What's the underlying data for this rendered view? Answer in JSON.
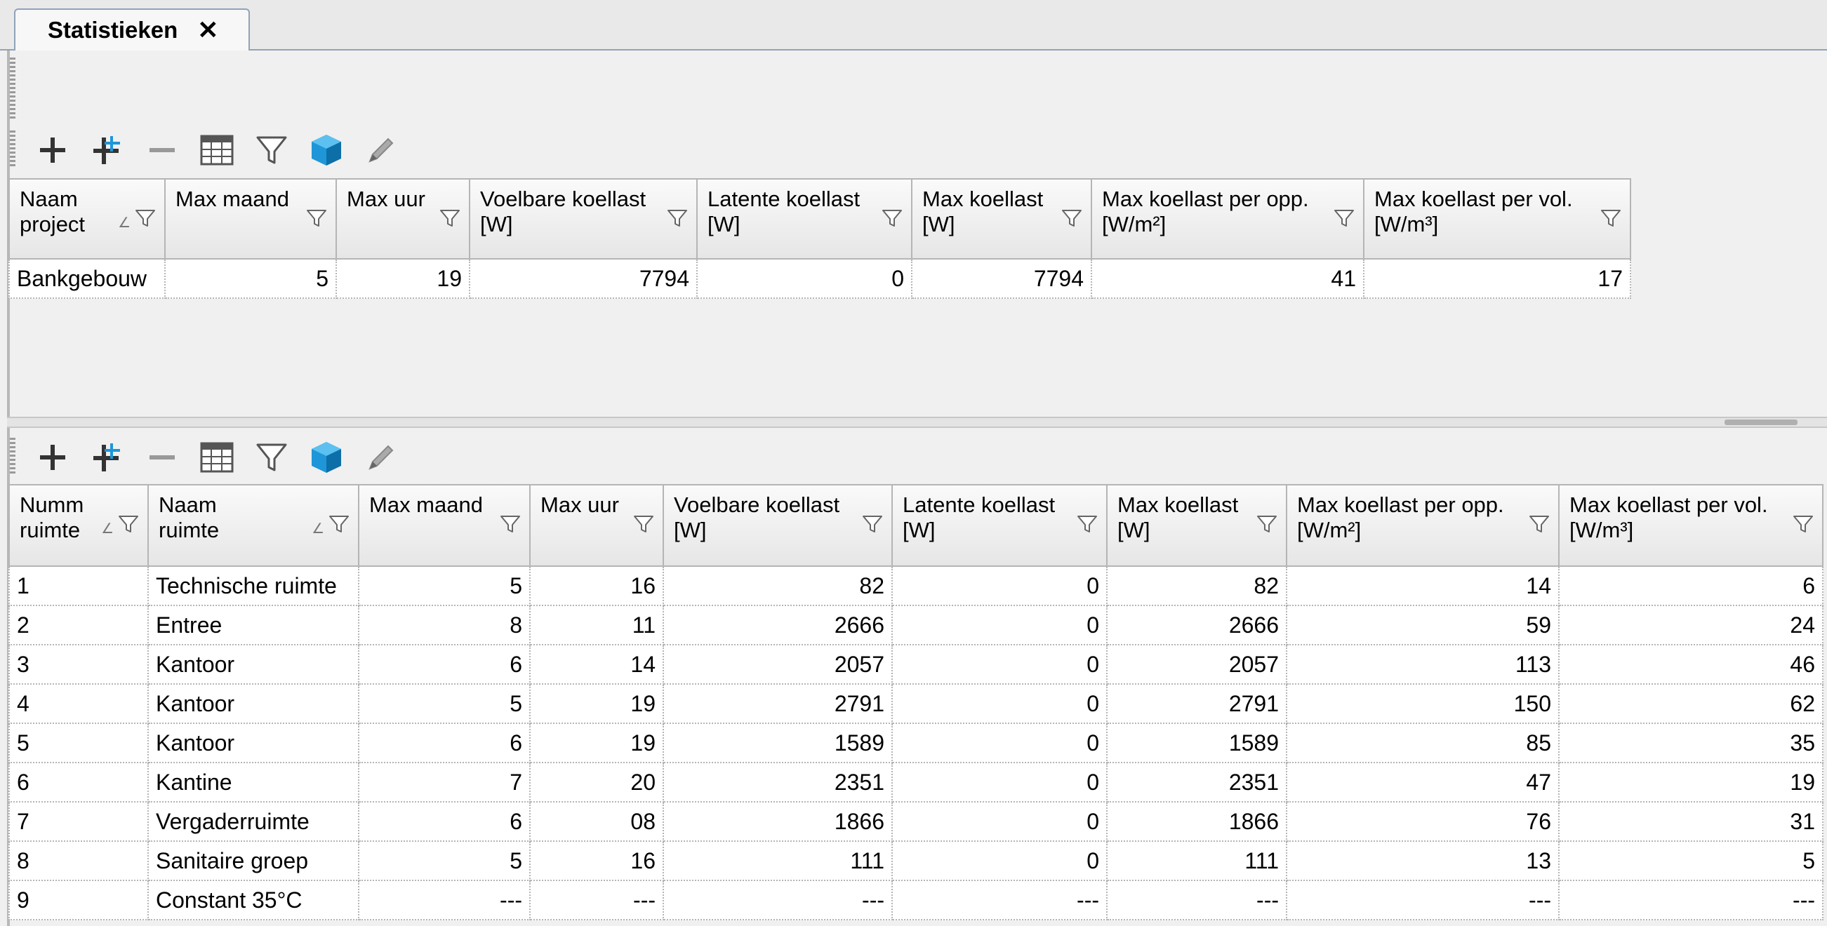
{
  "tab": {
    "label": "Statistieken",
    "close": "✕"
  },
  "toolbar": {
    "icons": [
      "add-icon",
      "add-multiple-icon",
      "remove-icon",
      "table-icon",
      "filter-icon",
      "3d-cube-icon",
      "edit-pencil-icon"
    ]
  },
  "project_grid": {
    "columns": [
      {
        "line1": "Naam",
        "line2": "project",
        "sortable": true
      },
      {
        "line1": "Max maand",
        "line2": ""
      },
      {
        "line1": "Max uur",
        "line2": ""
      },
      {
        "line1": "Voelbare koellast",
        "line2": "[W]"
      },
      {
        "line1": "Latente koellast",
        "line2": "[W]"
      },
      {
        "line1": "Max koellast",
        "line2": "[W]"
      },
      {
        "line1": "Max koellast per opp.",
        "line2": "[W/m²]"
      },
      {
        "line1": "Max koellast per vol.",
        "line2": "[W/m³]"
      }
    ],
    "rows": [
      [
        "Bankgebouw",
        "5",
        "19",
        "7794",
        "0",
        "7794",
        "41",
        "17"
      ]
    ]
  },
  "room_grid": {
    "columns": [
      {
        "line1": "Numm",
        "line2": "ruimte",
        "sortable": true
      },
      {
        "line1": "Naam",
        "line2": "ruimte",
        "sortable": true
      },
      {
        "line1": "Max maand",
        "line2": ""
      },
      {
        "line1": "Max uur",
        "line2": ""
      },
      {
        "line1": "Voelbare koellast",
        "line2": "[W]"
      },
      {
        "line1": "Latente koellast",
        "line2": "[W]"
      },
      {
        "line1": "Max koellast",
        "line2": "[W]"
      },
      {
        "line1": "Max koellast per opp.",
        "line2": "[W/m²]"
      },
      {
        "line1": "Max koellast per vol.",
        "line2": "[W/m³]"
      }
    ],
    "rows": [
      [
        "1",
        "Technische ruimte",
        "5",
        "16",
        "82",
        "0",
        "82",
        "14",
        "6"
      ],
      [
        "2",
        "Entree",
        "8",
        "11",
        "2666",
        "0",
        "2666",
        "59",
        "24"
      ],
      [
        "3",
        "Kantoor",
        "6",
        "14",
        "2057",
        "0",
        "2057",
        "113",
        "46"
      ],
      [
        "4",
        "Kantoor",
        "5",
        "19",
        "2791",
        "0",
        "2791",
        "150",
        "62"
      ],
      [
        "5",
        "Kantoor",
        "6",
        "19",
        "1589",
        "0",
        "1589",
        "85",
        "35"
      ],
      [
        "6",
        "Kantine",
        "7",
        "20",
        "2351",
        "0",
        "2351",
        "47",
        "19"
      ],
      [
        "7",
        "Vergaderruimte",
        "6",
        "08",
        "1866",
        "0",
        "1866",
        "76",
        "31"
      ],
      [
        "8",
        "Sanitaire groep",
        "5",
        "16",
        "111",
        "0",
        "111",
        "13",
        "5"
      ],
      [
        "9",
        "Constant 35°C",
        "---",
        "---",
        "---",
        "---",
        "---",
        "---",
        "---"
      ]
    ]
  },
  "colors": {
    "accent_blue": "#1e96d8",
    "grid_border": "#b5b5b5",
    "tab_border": "#8fa3b8"
  }
}
